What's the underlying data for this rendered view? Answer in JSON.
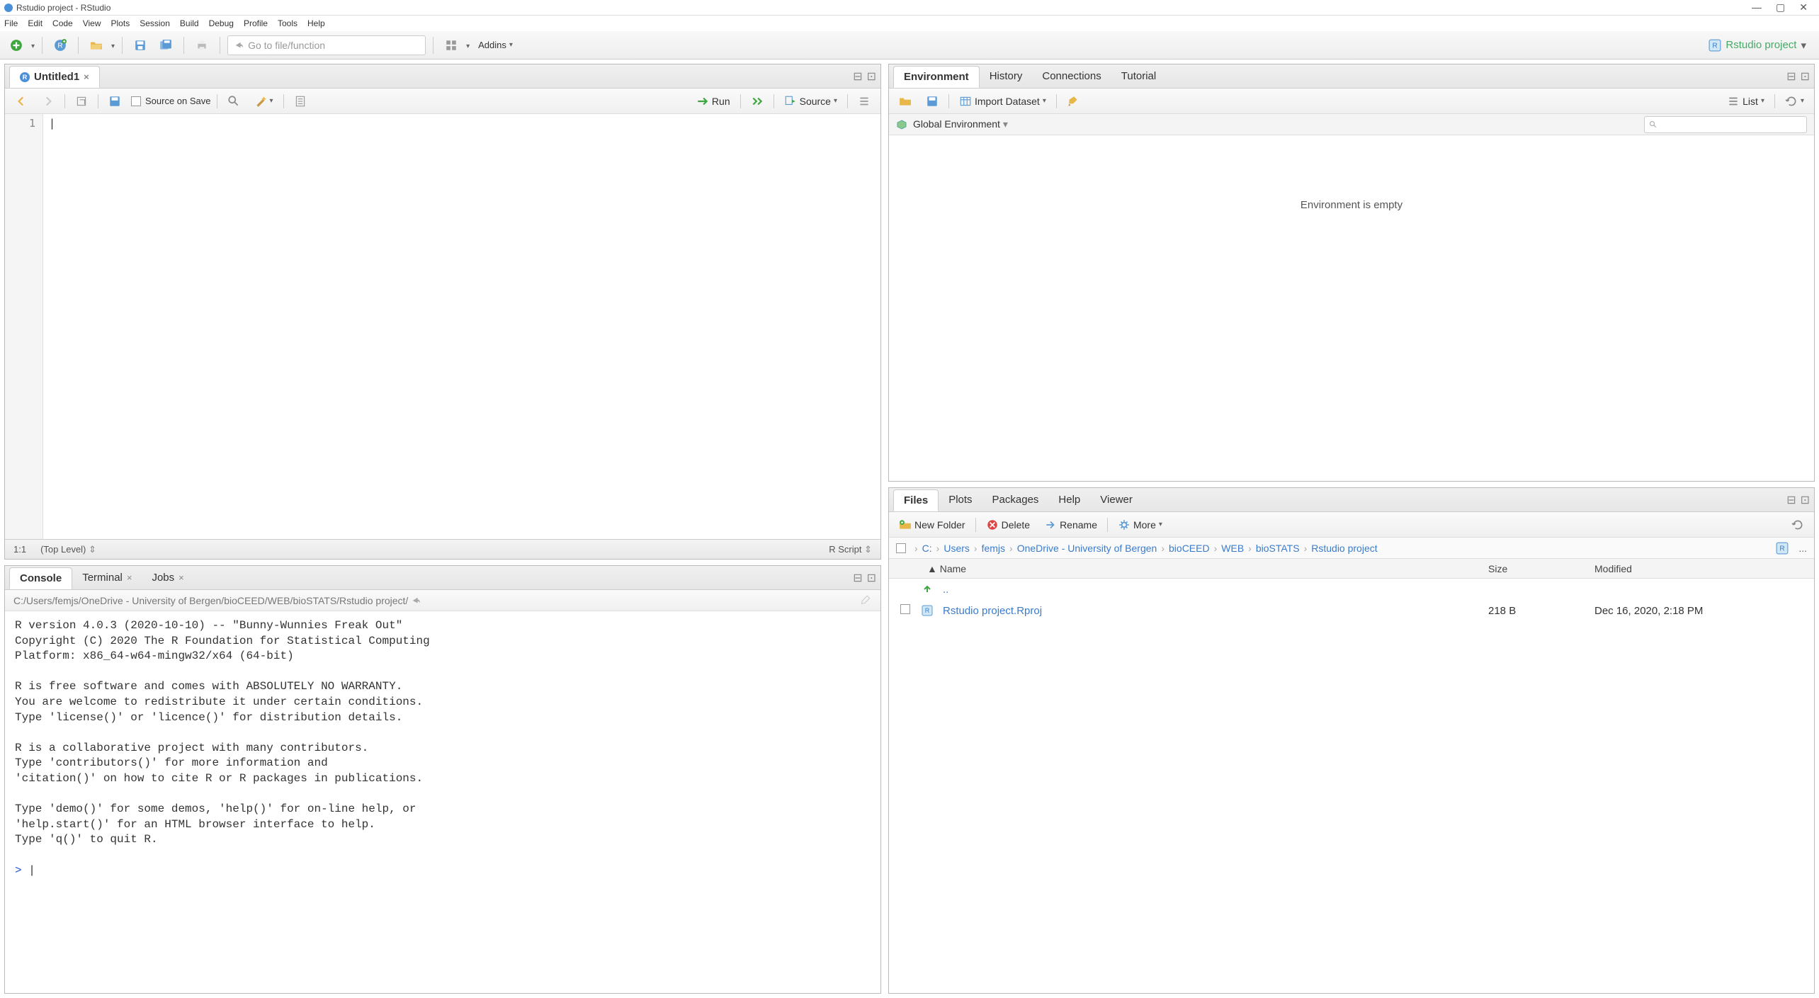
{
  "window": {
    "title": "Rstudio project - RStudio"
  },
  "menu": [
    "File",
    "Edit",
    "Code",
    "View",
    "Plots",
    "Session",
    "Build",
    "Debug",
    "Profile",
    "Tools",
    "Help"
  ],
  "toolbar": {
    "goto_placeholder": "Go to file/function",
    "addins": "Addins",
    "project": "Rstudio project"
  },
  "source": {
    "tab": "Untitled1",
    "source_on_save": "Source on Save",
    "run": "Run",
    "source_btn": "Source",
    "status_pos": "1:1",
    "status_scope": "(Top Level)",
    "status_lang": "R Script",
    "gutter": "1"
  },
  "console": {
    "tabs": {
      "console": "Console",
      "terminal": "Terminal",
      "jobs": "Jobs"
    },
    "path": "C:/Users/femjs/OneDrive - University of Bergen/bioCEED/WEB/bioSTATS/Rstudio project/",
    "text": "R version 4.0.3 (2020-10-10) -- \"Bunny-Wunnies Freak Out\"\nCopyright (C) 2020 The R Foundation for Statistical Computing\nPlatform: x86_64-w64-mingw32/x64 (64-bit)\n\nR is free software and comes with ABSOLUTELY NO WARRANTY.\nYou are welcome to redistribute it under certain conditions.\nType 'license()' or 'licence()' for distribution details.\n\nR is a collaborative project with many contributors.\nType 'contributors()' for more information and\n'citation()' on how to cite R or R packages in publications.\n\nType 'demo()' for some demos, 'help()' for on-line help, or\n'help.start()' for an HTML browser interface to help.\nType 'q()' to quit R.\n",
    "prompt": "> "
  },
  "env": {
    "tabs": {
      "env": "Environment",
      "hist": "History",
      "conn": "Connections",
      "tut": "Tutorial"
    },
    "import": "Import Dataset",
    "list": "List",
    "scope": "Global Environment",
    "empty": "Environment is empty"
  },
  "files": {
    "tabs": {
      "files": "Files",
      "plots": "Plots",
      "pkg": "Packages",
      "help": "Help",
      "viewer": "Viewer"
    },
    "toolbar": {
      "new_folder": "New Folder",
      "delete": "Delete",
      "rename": "Rename",
      "more": "More"
    },
    "breadcrumb": [
      "C:",
      "Users",
      "femjs",
      "OneDrive - University of Bergen",
      "bioCEED",
      "WEB",
      "bioSTATS",
      "Rstudio project"
    ],
    "cols": {
      "name": "Name",
      "size": "Size",
      "modified": "Modified"
    },
    "up": "..",
    "rows": [
      {
        "name": "Rstudio project.Rproj",
        "size": "218 B",
        "modified": "Dec 16, 2020, 2:18 PM"
      }
    ]
  }
}
